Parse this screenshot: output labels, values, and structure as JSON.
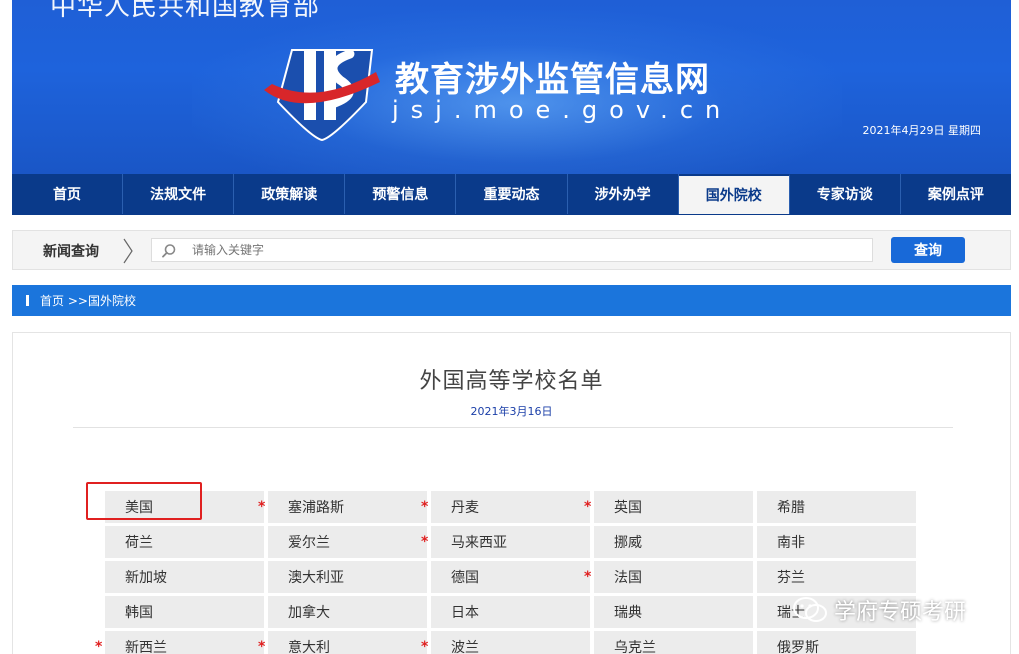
{
  "header": {
    "ministry": "中华人民共和国教育部",
    "site_title": "教育涉外监管信息网",
    "site_url": "jsj.moe.gov.cn",
    "date": "2021年4月29日  星期四"
  },
  "nav": {
    "items": [
      "首页",
      "法规文件",
      "政策解读",
      "预警信息",
      "重要动态",
      "涉外办学",
      "国外院校",
      "专家访谈",
      "案例点评"
    ],
    "active": "国外院校"
  },
  "search": {
    "label": "新闻查询",
    "placeholder": "请输入关键字",
    "button": "查询"
  },
  "breadcrumb": {
    "home": "首页",
    "current": ">>国外院校"
  },
  "article": {
    "title": "外国高等学校名单",
    "date": "2021年3月16日"
  },
  "countries": [
    {
      "name": "美国",
      "star": false
    },
    {
      "name": "塞浦路斯",
      "star": true
    },
    {
      "name": "丹麦",
      "star": true
    },
    {
      "name": "英国",
      "star": true
    },
    {
      "name": "希腊",
      "star": false
    },
    {
      "name": "荷兰",
      "star": false
    },
    {
      "name": "爱尔兰",
      "star": false
    },
    {
      "name": "马来西亚",
      "star": true
    },
    {
      "name": "挪威",
      "star": false
    },
    {
      "name": "南非",
      "star": false
    },
    {
      "name": "新加坡",
      "star": false
    },
    {
      "name": "澳大利亚",
      "star": false
    },
    {
      "name": "德国",
      "star": false
    },
    {
      "name": "法国",
      "star": true
    },
    {
      "name": "芬兰",
      "star": false
    },
    {
      "name": "韩国",
      "star": false
    },
    {
      "name": "加拿大",
      "star": false
    },
    {
      "name": "日本",
      "star": false
    },
    {
      "name": "瑞典",
      "star": false
    },
    {
      "name": "瑞士",
      "star": false
    },
    {
      "name": "新西兰",
      "star": true
    },
    {
      "name": "意大利",
      "star": true
    },
    {
      "name": "波兰",
      "star": true
    },
    {
      "name": "乌克兰",
      "star": false
    },
    {
      "name": "俄罗斯",
      "star": false
    }
  ],
  "star_symbol": "*",
  "watermark": "学府专硕考研",
  "colors": {
    "nav_bg": "#0a3a8a",
    "accent_blue": "#1b75dc",
    "star_red": "#e02020"
  }
}
